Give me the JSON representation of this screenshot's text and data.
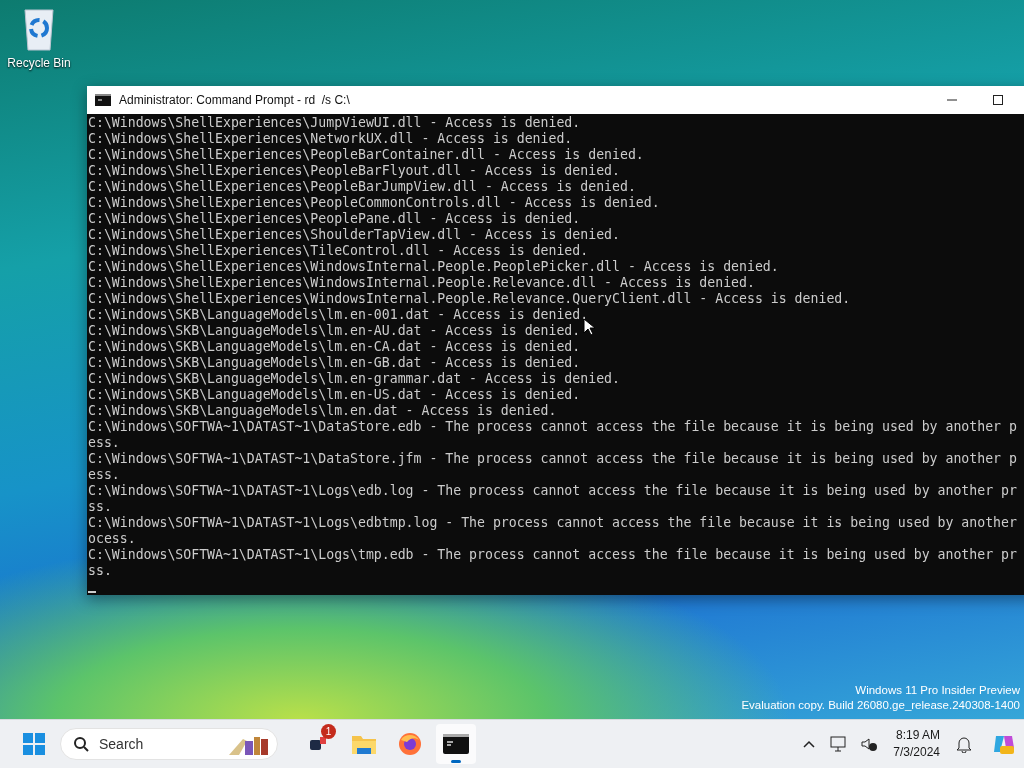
{
  "desktop": {
    "icons": [
      {
        "label": "Recycle Bin"
      }
    ],
    "watermark": [
      "Windows 11 Pro Insider Preview",
      "Evaluation copy. Build 26080.ge_release.240308-1400"
    ]
  },
  "window": {
    "title": "Administrator: Command Prompt - rd  /s C:\\",
    "console_lines": [
      "C:\\Windows\\ShellExperiences\\JumpViewUI.dll - Access is denied.",
      "C:\\Windows\\ShellExperiences\\NetworkUX.dll - Access is denied.",
      "C:\\Windows\\ShellExperiences\\PeopleBarContainer.dll - Access is denied.",
      "C:\\Windows\\ShellExperiences\\PeopleBarFlyout.dll - Access is denied.",
      "C:\\Windows\\ShellExperiences\\PeopleBarJumpView.dll - Access is denied.",
      "C:\\Windows\\ShellExperiences\\PeopleCommonControls.dll - Access is denied.",
      "C:\\Windows\\ShellExperiences\\PeoplePane.dll - Access is denied.",
      "C:\\Windows\\ShellExperiences\\ShoulderTapView.dll - Access is denied.",
      "C:\\Windows\\ShellExperiences\\TileControl.dll - Access is denied.",
      "C:\\Windows\\ShellExperiences\\WindowsInternal.People.PeoplePicker.dll - Access is denied.",
      "C:\\Windows\\ShellExperiences\\WindowsInternal.People.Relevance.dll - Access is denied.",
      "C:\\Windows\\ShellExperiences\\WindowsInternal.People.Relevance.QueryClient.dll - Access is denied.",
      "C:\\Windows\\SKB\\LanguageModels\\lm.en-001.dat - Access is denied.",
      "C:\\Windows\\SKB\\LanguageModels\\lm.en-AU.dat - Access is denied.",
      "C:\\Windows\\SKB\\LanguageModels\\lm.en-CA.dat - Access is denied.",
      "C:\\Windows\\SKB\\LanguageModels\\lm.en-GB.dat - Access is denied.",
      "C:\\Windows\\SKB\\LanguageModels\\lm.en-grammar.dat - Access is denied.",
      "C:\\Windows\\SKB\\LanguageModels\\lm.en-US.dat - Access is denied.",
      "C:\\Windows\\SKB\\LanguageModels\\lm.en.dat - Access is denied.",
      "C:\\Windows\\SOFTWA~1\\DATAST~1\\DataStore.edb - The process cannot access the file because it is being used by another p",
      "ess.",
      "C:\\Windows\\SOFTWA~1\\DATAST~1\\DataStore.jfm - The process cannot access the file because it is being used by another p",
      "ess.",
      "C:\\Windows\\SOFTWA~1\\DATAST~1\\Logs\\edb.log - The process cannot access the file because it is being used by another pr",
      "ss.",
      "C:\\Windows\\SOFTWA~1\\DATAST~1\\Logs\\edbtmp.log - The process cannot access the file because it is being used by another",
      "ocess.",
      "C:\\Windows\\SOFTWA~1\\DATAST~1\\Logs\\tmp.edb - The process cannot access the file because it is being used by another pr",
      "ss."
    ]
  },
  "taskbar": {
    "search": {
      "placeholder": "Search"
    },
    "apps": [
      {
        "kind": "messages",
        "selected": false,
        "badge": "1"
      },
      {
        "kind": "explorer",
        "selected": false
      },
      {
        "kind": "firefox",
        "selected": false
      },
      {
        "kind": "terminal",
        "selected": true
      }
    ],
    "clock": {
      "time": "8:19 AM",
      "date": "7/3/2024"
    }
  }
}
